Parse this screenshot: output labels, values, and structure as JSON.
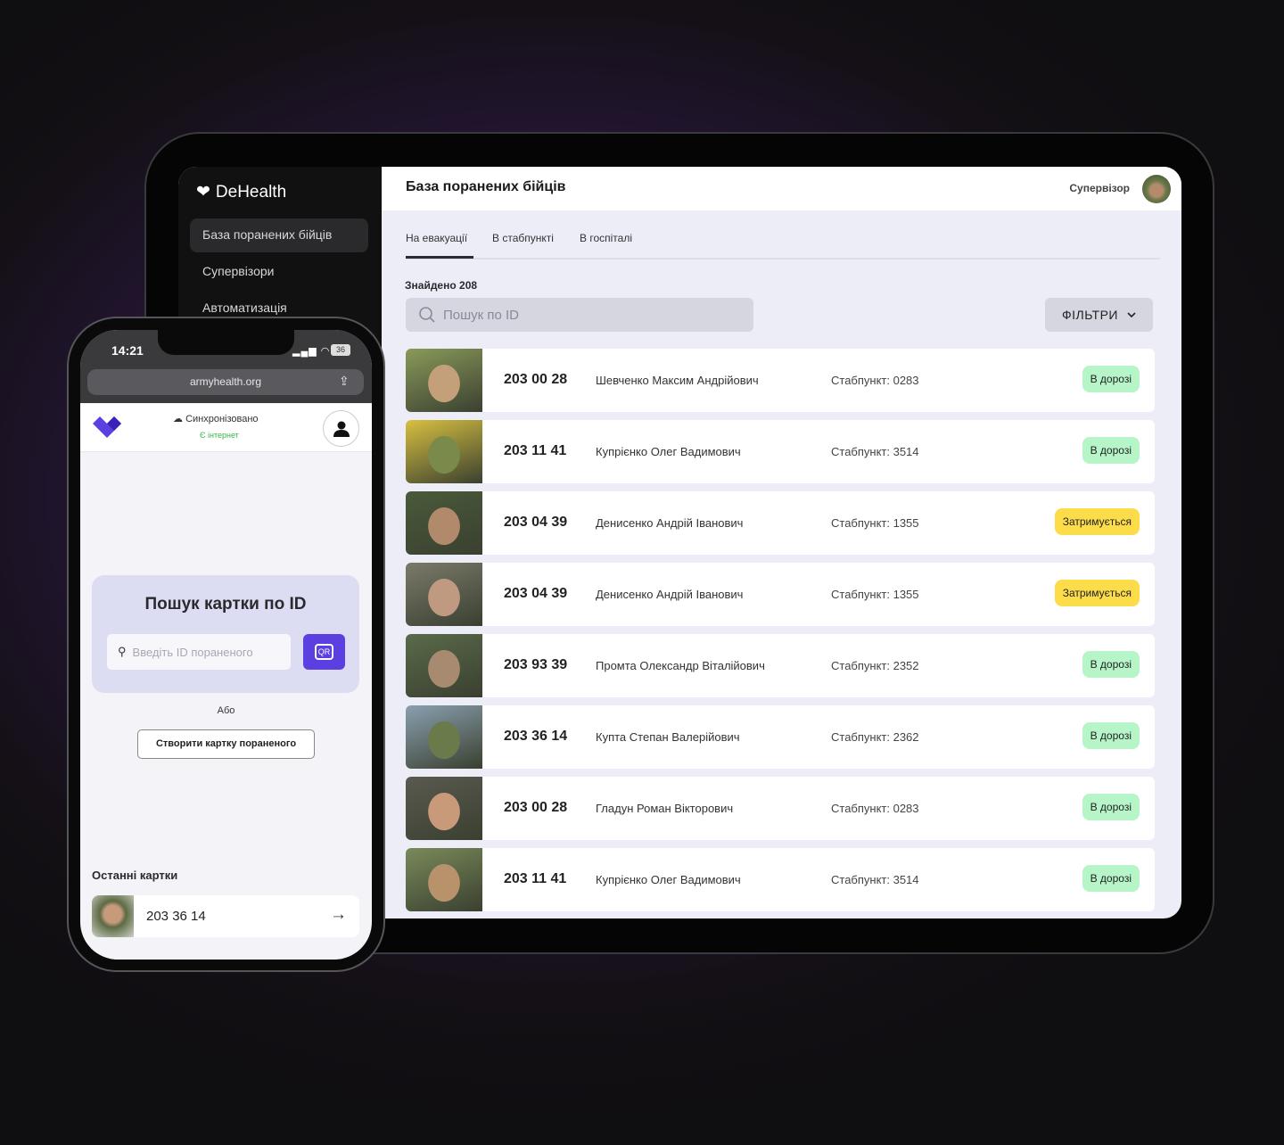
{
  "sidebar": {
    "brand": "DeHealth",
    "items": [
      {
        "label": "База поранених бійців"
      },
      {
        "label": "Супервізори"
      },
      {
        "label": "Автоматизація"
      }
    ]
  },
  "header": {
    "title": "База поранених бійців",
    "role": "Супервізор"
  },
  "tabs": [
    {
      "label": "На евакуації"
    },
    {
      "label": "В стабпункті"
    },
    {
      "label": "В госпіталі"
    }
  ],
  "found": "Знайдено 208",
  "search": {
    "placeholder": "Пошук по ID"
  },
  "filter_label": "ФІЛЬТРИ",
  "colors": {
    "on_road": "#b5f5c8",
    "delayed": "#fddc4a",
    "accent": "#5b3fe0"
  },
  "rows": [
    {
      "id": "203 00 28",
      "name": "Шевченко Максим Андрійович",
      "stab": "Стабпункт: 0283",
      "status": "В дорозі",
      "kind": "on_road"
    },
    {
      "id": "203 11 41",
      "name": "Купрієнко Олег Вадимович",
      "stab": "Стабпункт: 3514",
      "status": "В дорозі",
      "kind": "on_road"
    },
    {
      "id": "203 04 39",
      "name": "Денисенко Андрій Іванович",
      "stab": "Стабпункт: 1355",
      "status": "Затримується",
      "kind": "delayed"
    },
    {
      "id": "203 04 39",
      "name": "Денисенко Андрій Іванович",
      "stab": "Стабпункт: 1355",
      "status": "Затримується",
      "kind": "delayed"
    },
    {
      "id": "203 93 39",
      "name": "Промта Олександр Віталійович",
      "stab": "Стабпункт: 2352",
      "status": "В дорозі",
      "kind": "on_road"
    },
    {
      "id": "203 36 14",
      "name": "Купта Степан Валерійович",
      "stab": "Стабпункт: 2362",
      "status": "В дорозі",
      "kind": "on_road"
    },
    {
      "id": "203 00 28",
      "name": "Гладун Роман Вікторович",
      "stab": "Стабпункт: 0283",
      "status": "В дорозі",
      "kind": "on_road"
    },
    {
      "id": "203 11 41",
      "name": "Купрієнко Олег Вадимович",
      "stab": "Стабпункт: 3514",
      "status": "В дорозі",
      "kind": "on_road"
    }
  ],
  "phone": {
    "time": "14:21",
    "battery": "36",
    "url": "armyhealth.org",
    "sync": "Синхронізовано",
    "internet": "Є інтернет",
    "card_title": "Пошук картки по ID",
    "input_placeholder": "Введіть ID пораненого",
    "qr_label": "QR",
    "or": "Або",
    "create_button": "Створити картку пораненого",
    "recent_title": "Останні картки",
    "recent_id": "203 36 14"
  }
}
